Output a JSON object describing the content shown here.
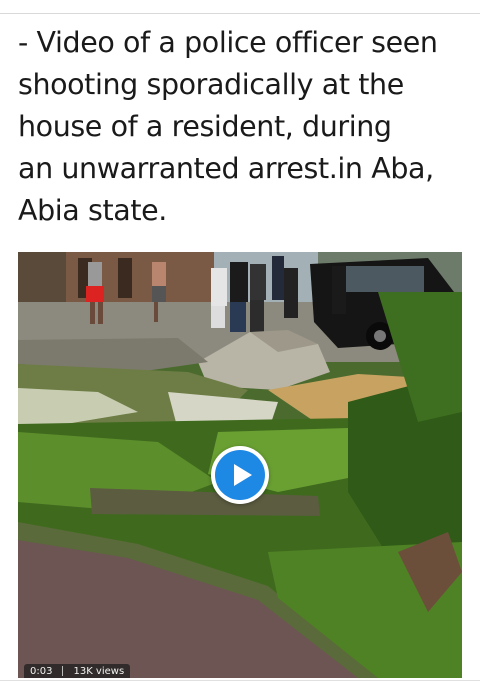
{
  "post": {
    "caption": "- Video of a police officer seen\nshooting sporadically at the\nhouse of a resident, during\nan unwarranted arrest.in Aba,\nAbia state."
  },
  "video": {
    "duration": "0:03",
    "views": "13K views",
    "play_button_color": "#1e88e5"
  }
}
